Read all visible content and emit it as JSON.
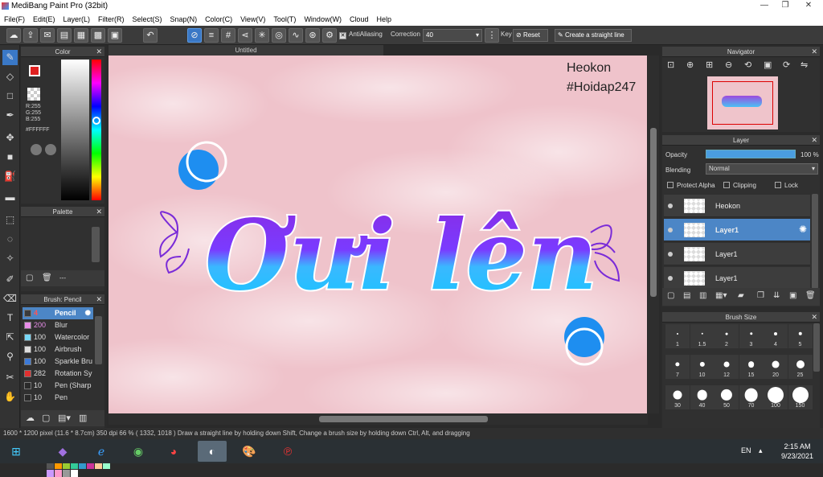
{
  "window": {
    "title": "MediBang Paint Pro (32bit)"
  },
  "menu": [
    "File(F)",
    "Edit(E)",
    "Layer(L)",
    "Filter(R)",
    "Select(S)",
    "Snap(N)",
    "Color(C)",
    "View(V)",
    "Tool(T)",
    "Window(W)",
    "Cloud",
    "Help"
  ],
  "toolbar": {
    "antialiasing_label": "AntiAliasing",
    "correction_label": "Correction",
    "correction_value": "40",
    "key_label": "Key",
    "reset_label": "Reset",
    "straight_line_label": "Create a straight line"
  },
  "color_panel": {
    "title": "Color",
    "r": "R:255",
    "g": "G:255",
    "b": "B:255",
    "hex": "#FFFFFF"
  },
  "palette_panel": {
    "title": "Palette",
    "more": "---"
  },
  "brush_panel": {
    "title": "Brush: Pencil",
    "items": [
      {
        "size": "4",
        "name": "Pencil",
        "color": "#3b3b3b"
      },
      {
        "size": "200",
        "name": "Blur",
        "color": "#e88de8"
      },
      {
        "size": "100",
        "name": "Watercolor",
        "color": "#78d8f8"
      },
      {
        "size": "100",
        "name": "Airbrush",
        "color": "#dddddd"
      },
      {
        "size": "100",
        "name": "Sparkle Bru",
        "color": "#3c7ad8"
      },
      {
        "size": "282",
        "name": "Rotation Sy",
        "color": "#e03030"
      },
      {
        "size": "10",
        "name": "Pen (Sharp",
        "color": "#2a2a2a"
      },
      {
        "size": "10",
        "name": "Pen",
        "color": "#2a2a2a"
      }
    ]
  },
  "document": {
    "tab_title": "Untitled"
  },
  "canvas": {
    "watermark_line1": "Heokon",
    "watermark_line2": "#Hoidap247",
    "lettering": "Ơưi lên"
  },
  "navigator_panel": {
    "title": "Navigator"
  },
  "layer_panel": {
    "title": "Layer",
    "opacity_label": "Opacity",
    "opacity_value": "100 %",
    "opacity": 100,
    "blending_label": "Blending",
    "blending_value": "Normal",
    "protect_alpha": "Protect Alpha",
    "clipping": "Clipping",
    "lock": "Lock",
    "layers": [
      {
        "name": "Heokon"
      },
      {
        "name": "Layer1"
      },
      {
        "name": "Layer1"
      },
      {
        "name": "Layer1"
      }
    ]
  },
  "brush_size_panel": {
    "title": "Brush Size",
    "sizes": [
      "1",
      "1.5",
      "2",
      "3",
      "4",
      "5",
      "7",
      "10",
      "12",
      "15",
      "20",
      "25",
      "30",
      "40",
      "50",
      "70",
      "100",
      "150"
    ]
  },
  "status_bar": {
    "text": "1600 * 1200 pixel   (11.6 * 8.7cm)   350 dpi   66 %   ( 1332, 1018 )   Draw a straight line by holding down Shift, Change a brush size by holding down Ctrl, Alt, and dragging"
  },
  "taskbar": {
    "lang": "EN",
    "time": "2:15 AM",
    "date": "9/23/2021"
  },
  "colors": {
    "accent": "#3a78c6",
    "fg_color": "#e02020"
  }
}
